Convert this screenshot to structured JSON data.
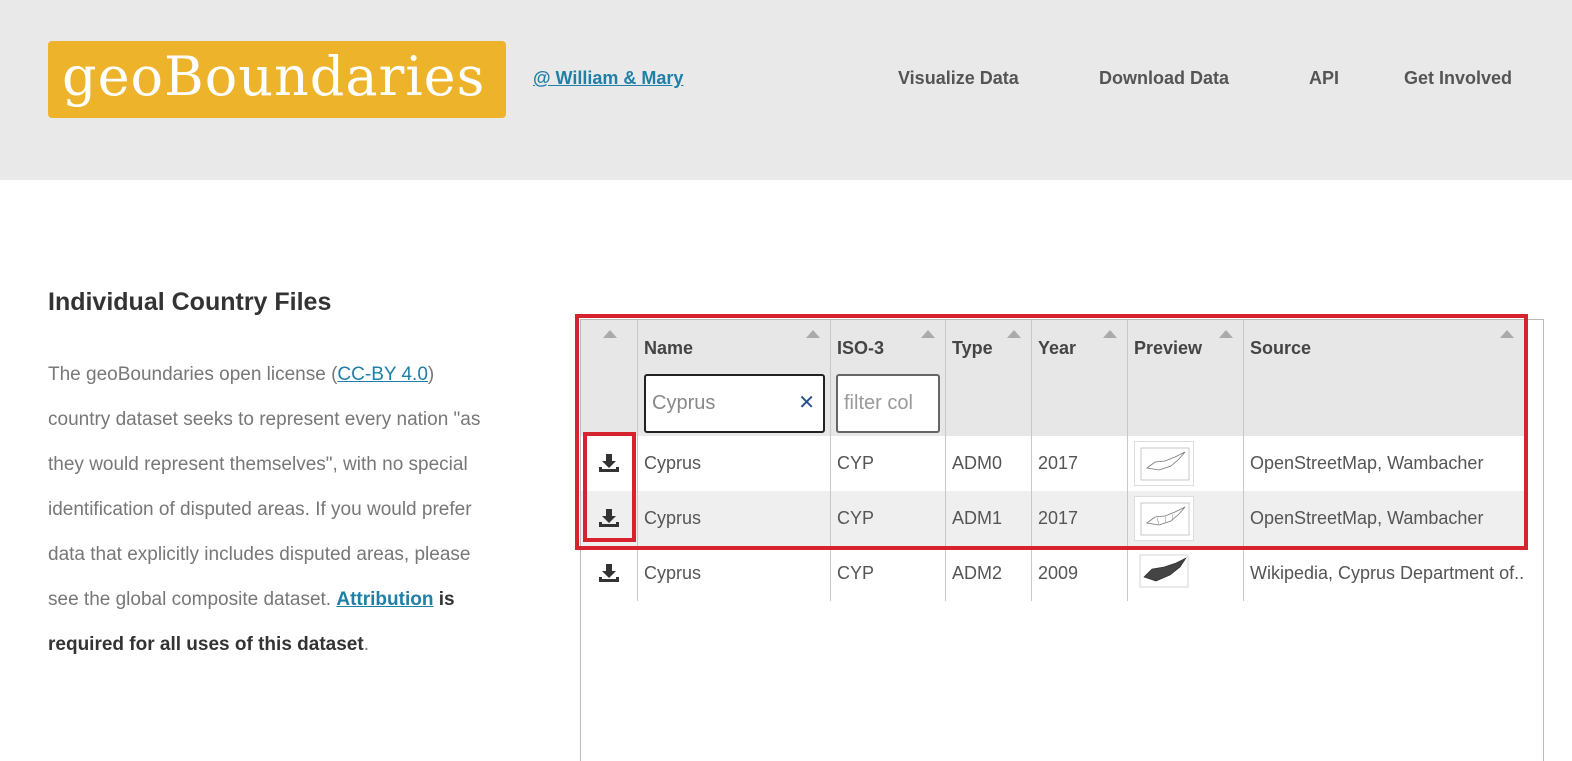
{
  "header": {
    "logo_text": "geoBoundaries",
    "affiliation_link": "@ William & Mary",
    "nav": [
      "Visualize Data",
      "Download Data",
      "API",
      "Get Involved"
    ]
  },
  "intro": {
    "title": "Individual Country Files",
    "p1": "The geoBoundaries open license (",
    "license_link": "CC-BY 4.0",
    "p2": ") country dataset seeks to represent every nation \"as they would represent themselves\", with no special identification of disputed areas. If you would prefer data that explicitly includes disputed areas, please see the global composite dataset. ",
    "attribution_link": "Attribution",
    "p3": " is required for all uses of this dataset",
    "p4": "."
  },
  "table": {
    "columns": [
      "Name",
      "ISO-3",
      "Type",
      "Year",
      "Preview",
      "Source"
    ],
    "filters": {
      "name_value": "Cyprus",
      "iso_placeholder": "filter col"
    },
    "rows": [
      {
        "name": "Cyprus",
        "iso": "CYP",
        "type": "ADM0",
        "year": "2017",
        "source": "OpenStreetMap, Wambacher"
      },
      {
        "name": "Cyprus",
        "iso": "CYP",
        "type": "ADM1",
        "year": "2017",
        "source": "OpenStreetMap, Wambacher"
      },
      {
        "name": "Cyprus",
        "iso": "CYP",
        "type": "ADM2",
        "year": "2009",
        "source": "Wikipedia, Cyprus Department of..."
      }
    ]
  },
  "icons": {
    "download": "download-icon",
    "clear": "close-icon",
    "sort": "sort-arrow-icon"
  },
  "colors": {
    "logo_bg": "#edb32a",
    "link": "#1f7fa6",
    "highlight": "#d6232d",
    "header_bg": "#e9e9e9"
  }
}
